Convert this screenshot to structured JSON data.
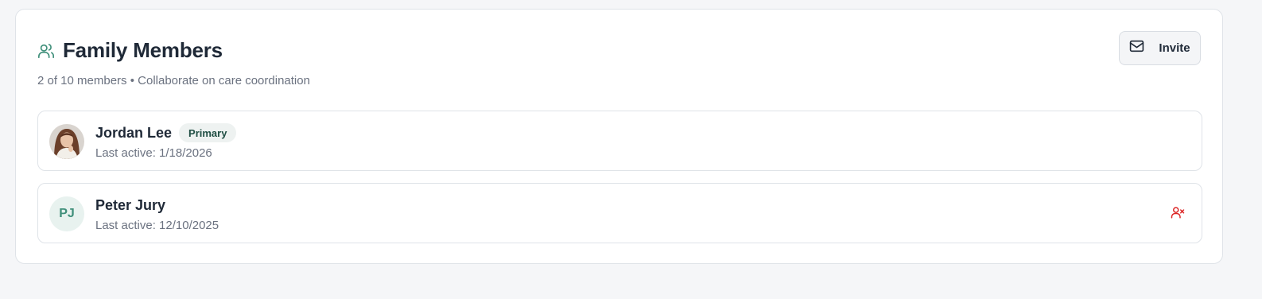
{
  "panel": {
    "title": "Family Members",
    "subtitle": "2 of 10 members • Collaborate on care coordination",
    "title_icon": "users-icon",
    "accent_color": "#3f8f7a"
  },
  "invite": {
    "label": "Invite",
    "icon": "mail-icon"
  },
  "members": [
    {
      "name": "Jordan Lee",
      "badge": "Primary",
      "last_active": "Last active: 1/18/2026",
      "avatar": "photo"
    },
    {
      "name": "Peter Jury",
      "initials": "PJ",
      "last_active": "Last active: 12/10/2025",
      "action_icon": "user-remove-icon",
      "action_color": "#dc2626"
    }
  ]
}
